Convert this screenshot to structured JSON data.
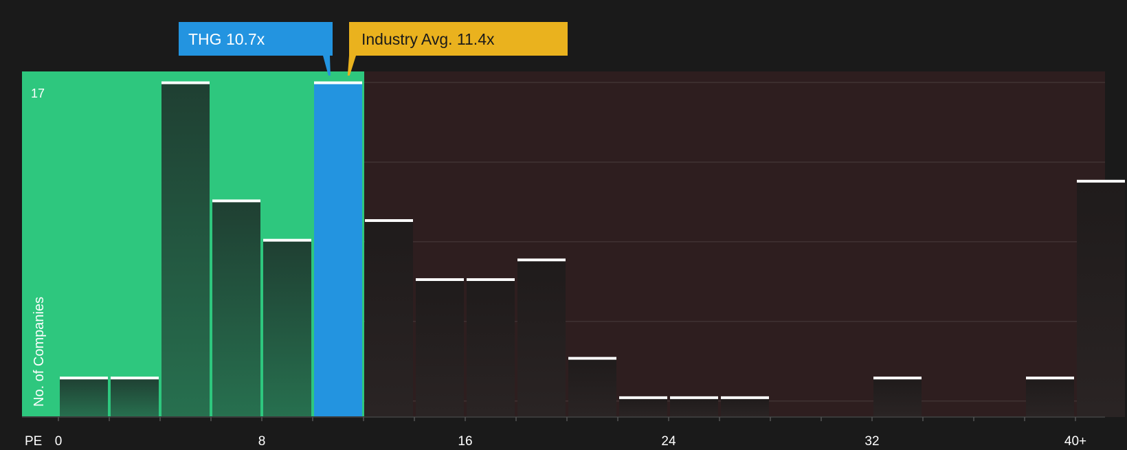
{
  "chart_data": {
    "type": "bar",
    "ylabel": "No. of Companies",
    "xlabel": "PE",
    "y_top_label": "17",
    "ylim": [
      0,
      17
    ],
    "x_ticks": [
      {
        "value": 0,
        "label": "0"
      },
      {
        "value": 8,
        "label": "8"
      },
      {
        "value": 16,
        "label": "16"
      },
      {
        "value": 24,
        "label": "24"
      },
      {
        "value": 32,
        "label": "32"
      },
      {
        "value": 40,
        "label": "40+"
      }
    ],
    "bin_width": 2,
    "bins": [
      {
        "start": 0,
        "count": 2
      },
      {
        "start": 2,
        "count": 2
      },
      {
        "start": 4,
        "count": 17
      },
      {
        "start": 6,
        "count": 11
      },
      {
        "start": 8,
        "count": 9
      },
      {
        "start": 10,
        "count": 17,
        "highlight": true
      },
      {
        "start": 12,
        "count": 10
      },
      {
        "start": 14,
        "count": 7
      },
      {
        "start": 16,
        "count": 7
      },
      {
        "start": 18,
        "count": 8
      },
      {
        "start": 20,
        "count": 3
      },
      {
        "start": 22,
        "count": 1
      },
      {
        "start": 24,
        "count": 1
      },
      {
        "start": 26,
        "count": 1
      },
      {
        "start": 28,
        "count": 0
      },
      {
        "start": 30,
        "count": 0
      },
      {
        "start": 32,
        "count": 2
      },
      {
        "start": 34,
        "count": 0
      },
      {
        "start": 36,
        "count": 0
      },
      {
        "start": 38,
        "count": 2
      },
      {
        "start": 40,
        "count": 12
      }
    ],
    "company": {
      "label": "THG 10.7x",
      "value": 10.7
    },
    "industry": {
      "label": "Industry Avg. 11.4x",
      "value": 11.4
    },
    "colors": {
      "background": "#1a1a1a",
      "green_zone": "#2ec77e",
      "red_zone": "#2e1e1f",
      "highlight": "#2394e0",
      "industry": "#eab21e",
      "bar_cap": "#ffffff",
      "text": "#ffffff"
    }
  }
}
